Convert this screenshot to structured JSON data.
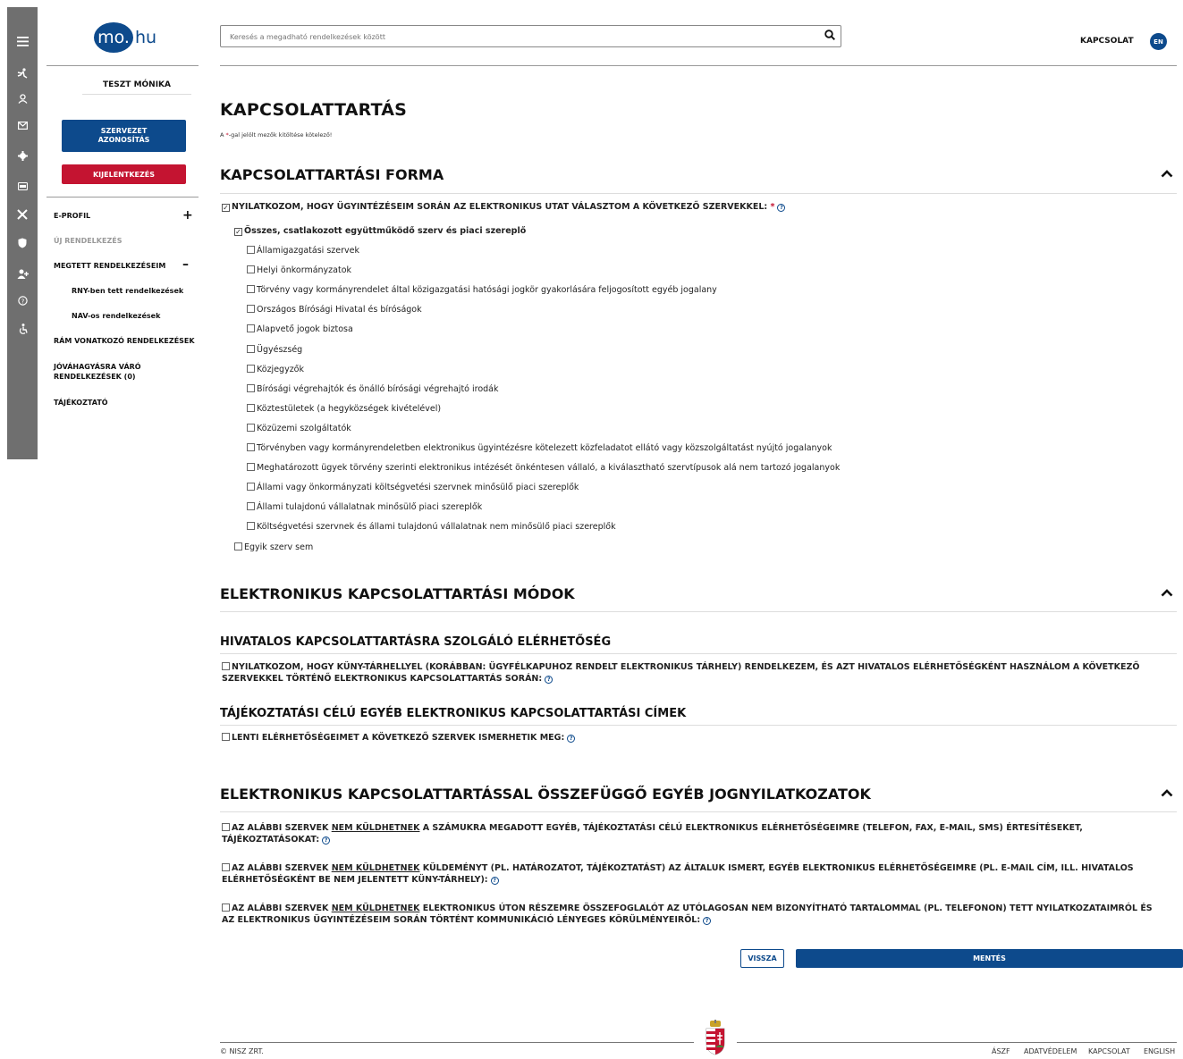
{
  "rail_icons": [
    "menu-icon",
    "person-walk-icon",
    "user-icon",
    "mail-icon",
    "gear-icon",
    "card-icon",
    "tools-icon",
    "shield-icon",
    "user-add-icon",
    "help-icon",
    "accessibility-icon"
  ],
  "logo": {
    "mo": "mo.",
    "hu": "hu"
  },
  "user": {
    "name": "TESZT MÓNIKA"
  },
  "buttons": {
    "org_id": "SZERVEZET AZONOSÍTÁS",
    "logout": "KIJELENTKEZÉS"
  },
  "nav": {
    "eprofil": "E-PROFIL",
    "uj": "ÚJ RENDELKEZÉS",
    "megtett": "MEGTETT RENDELKEZÉSEIM",
    "rny": "RNY-ben tett rendelkezések",
    "nav": "NAV-os rendelkezések",
    "ram": "RÁM VONATKOZÓ RENDELKEZÉSEK",
    "jovahagyas1": "JÓVÁHAGYÁSRA VÁRÓ",
    "jovahagyas2": "RENDELKEZÉSEK (0)",
    "tajekoztato": "TÁJÉKOZTATÓ",
    "plus": "+",
    "minus": "–"
  },
  "search": {
    "placeholder": "Keresés a megadható rendelkezések között"
  },
  "header": {
    "contact": "KAPCSOLAT",
    "lang": "EN"
  },
  "page": {
    "title": "KAPCSOLATTARTÁS",
    "req_a": "A ",
    "req_star": "*",
    "req_b": "-gal jelölt mezők kitöltése kötelező!"
  },
  "section1": {
    "title": "KAPCSOLATTARTÁSI FORMA",
    "declaration": "NYILATKOZOM, HOGY ÜGYINTÉZÉSEIM SORÁN AZ ELEKTRONIKUS UTAT VÁLASZTOM A KÖVETKEZŐ SZERVEKKEL:",
    "all": "Összes, csatlakozott együttműködő szerv és piaci szereplő",
    "items": [
      "Államigazgatási szervek",
      "Helyi önkormányzatok",
      "Törvény vagy kormányrendelet által közigazgatási hatósági jogkör gyakorlására feljogosított egyéb jogalany",
      "Országos Bírósági Hivatal és bíróságok",
      "Alapvető jogok biztosa",
      "Ügyészség",
      "Közjegyzők",
      "Bírósági végrehajtók és önálló bírósági végrehajtó irodák",
      "Köztestületek (a hegyközségek kivételével)",
      "Közüzemi szolgáltatók",
      "Törvényben vagy kormányrendeletben elektronikus ügyintézésre kötelezett közfeladatot ellátó vagy közszolgáltatást nyújtó jogalanyok",
      "Meghatározott ügyek törvény szerinti elektronikus intézését önkéntesen vállaló, a kiválasztható szervtípusok alá nem tartozó jogalanyok",
      "Állami vagy önkormányzati költségvetési szervnek minősülő piaci szereplők",
      "Állami tulajdonú vállalatnak minősülő piaci szereplők",
      "Költségvetési szervnek és állami tulajdonú vállalatnak nem minősülő piaci szereplők"
    ],
    "none": "Egyik szerv sem"
  },
  "section2": {
    "title": "ELEKTRONIKUS KAPCSOLATTARTÁSI MÓDOK",
    "sub1": "HIVATALOS KAPCSOLATTARTÁSRA SZOLGÁLÓ ELÉRHETŐSÉG",
    "decl1a": "NYILATKOZOM, HOGY KÜNY-TÁRHELLYEL (KORÁBBAN: ÜGYFÉLKAPUHOZ RENDELT ELEKTRONIKUS TÁRHELY) RENDELKEZEM, ÉS AZT HIVATALOS ELÉRHETŐSÉGKÉNT HASZNÁLOM A KÖVETKEZŐ",
    "decl1b": "SZERVEKKEL TÖRTÉNŐ ELEKTRONIKUS KAPCSOLATTARTÁS SORÁN:",
    "sub2": "TÁJÉKOZTATÁSI CÉLÚ EGYÉB ELEKTRONIKUS KAPCSOLATTARTÁSI CÍMEK",
    "decl2": "LENTI ELÉRHETŐSÉGEIMET A KÖVETKEZŐ SZERVEK ISMERHETIK MEG:"
  },
  "section3": {
    "title": "ELEKTRONIKUS KAPCSOLATTARTÁSSAL ÖSSZEFÜGGŐ EGYÉB JOGNYILATKOZATOK",
    "pre": "AZ ALÁBBI SZERVEK ",
    "nem": "NEM KÜLDHETNEK",
    "d1a": " A SZÁMUKRA MEGADOTT EGYÉB, TÁJÉKOZTATÁSI CÉLÚ ELEKTRONIKUS ELÉRHETŐSÉGEIMRE (TELEFON, FAX, E-MAIL, SMS) ÉRTESÍTÉSEKET,",
    "d1b": "TÁJÉKOZTATÁSOKAT:",
    "d2a": " KÜLDEMÉNYT (PL. HATÁROZATOT, TÁJÉKOZTATÁST) AZ ÁLTALUK ISMERT, EGYÉB ELEKTRONIKUS ELÉRHETŐSÉGEIMRE (PL. E-MAIL CÍM, ILL. HIVATALOS",
    "d2b": "ELÉRHETŐSÉGKÉNT BE NEM JELENTETT KÜNY-TÁRHELY):",
    "d3a": " ELEKTRONIKUS ÚTON RÉSZEMRE ÖSSZEFOGLALÓT AZ UTÓLAGOSAN NEM BIZONYÍTHATÓ TARTALOMMAL (PL. TELEFONON) TETT NYILATKOZATAIMRÓL ÉS",
    "d3b": "AZ ELEKTRONIKUS ÜGYINTÉZÉSEIM SORÁN TÖRTÉNT KOMMUNIKÁCIÓ LÉNYEGES KÖRÜLMÉNYEIRŐL:"
  },
  "actions": {
    "back": "VISSZA",
    "save": "MENTÉS"
  },
  "footer": {
    "copy": "© NISZ ZRT.",
    "links": [
      "ÁSZF",
      "ADATVÉDELEM",
      "KAPCSOLAT",
      "ENGLISH"
    ]
  }
}
